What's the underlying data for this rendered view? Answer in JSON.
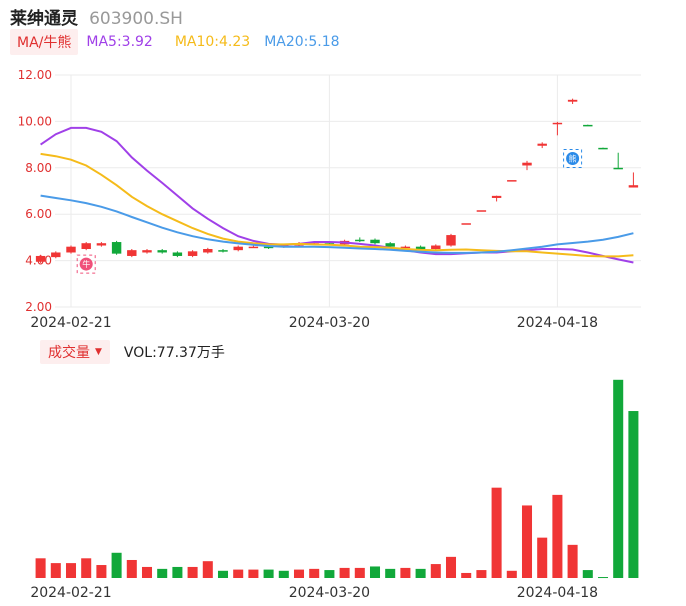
{
  "header": {
    "name": "莱绅通灵",
    "code": "603900.SH"
  },
  "ma_legend": {
    "tag": "MA/牛熊",
    "items": [
      {
        "label": "MA5:3.92",
        "color": "#a040e8"
      },
      {
        "label": "MA10:4.23",
        "color": "#f5bb1a"
      },
      {
        "label": "MA20:5.18",
        "color": "#4a9be8"
      }
    ]
  },
  "volume_legend": {
    "tag": "成交量",
    "label": "VOL:77.37万手"
  },
  "colors": {
    "up": "#f03535",
    "down": "#11a83a",
    "grid": "#ebebeb",
    "axis_text": "#e03030"
  },
  "chart_data": [
    {
      "type": "candlestick",
      "ylim": [
        2.0,
        12.0
      ],
      "yticks": [
        "2.00",
        "4.00",
        "6.00",
        "8.00",
        "10.00",
        "12.00"
      ],
      "xticks": [
        {
          "index": 2,
          "label": "2024-02-21"
        },
        {
          "index": 19,
          "label": "2024-03-20"
        },
        {
          "index": 34,
          "label": "2024-04-18"
        }
      ],
      "markers": [
        {
          "index": 3,
          "value": 3.85,
          "type": "bull",
          "glyph": "牛"
        },
        {
          "index": 35,
          "value": 8.4,
          "type": "bear",
          "glyph": "熊"
        }
      ],
      "candles": [
        {
          "o": 3.95,
          "c": 4.2,
          "h": 4.25,
          "l": 3.9
        },
        {
          "o": 4.15,
          "c": 4.35,
          "h": 4.4,
          "l": 4.1
        },
        {
          "o": 4.35,
          "c": 4.6,
          "h": 4.65,
          "l": 4.3
        },
        {
          "o": 4.5,
          "c": 4.75,
          "h": 4.8,
          "l": 4.45
        },
        {
          "o": 4.65,
          "c": 4.75,
          "h": 4.8,
          "l": 4.6
        },
        {
          "o": 4.8,
          "c": 4.3,
          "h": 4.85,
          "l": 4.25
        },
        {
          "o": 4.2,
          "c": 4.45,
          "h": 4.5,
          "l": 4.15
        },
        {
          "o": 4.35,
          "c": 4.45,
          "h": 4.5,
          "l": 4.3
        },
        {
          "o": 4.45,
          "c": 4.35,
          "h": 4.5,
          "l": 4.3
        },
        {
          "o": 4.35,
          "c": 4.2,
          "h": 4.4,
          "l": 4.15
        },
        {
          "o": 4.2,
          "c": 4.4,
          "h": 4.45,
          "l": 4.15
        },
        {
          "o": 4.35,
          "c": 4.5,
          "h": 4.55,
          "l": 4.3
        },
        {
          "o": 4.45,
          "c": 4.4,
          "h": 4.5,
          "l": 4.35
        },
        {
          "o": 4.45,
          "c": 4.6,
          "h": 4.65,
          "l": 4.4
        },
        {
          "o": 4.6,
          "c": 4.6,
          "h": 4.65,
          "l": 4.55
        },
        {
          "o": 4.6,
          "c": 4.55,
          "h": 4.65,
          "l": 4.5
        },
        {
          "o": 4.6,
          "c": 4.65,
          "h": 4.7,
          "l": 4.55
        },
        {
          "o": 4.65,
          "c": 4.75,
          "h": 4.8,
          "l": 4.6
        },
        {
          "o": 4.75,
          "c": 4.75,
          "h": 4.8,
          "l": 4.7
        },
        {
          "o": 4.75,
          "c": 4.7,
          "h": 4.8,
          "l": 4.65
        },
        {
          "o": 4.7,
          "c": 4.85,
          "h": 4.9,
          "l": 4.65
        },
        {
          "o": 4.9,
          "c": 4.85,
          "h": 5.0,
          "l": 4.8
        },
        {
          "o": 4.9,
          "c": 4.75,
          "h": 4.95,
          "l": 4.7
        },
        {
          "o": 4.75,
          "c": 4.6,
          "h": 4.8,
          "l": 4.55
        },
        {
          "o": 4.55,
          "c": 4.6,
          "h": 4.65,
          "l": 4.5
        },
        {
          "o": 4.6,
          "c": 4.5,
          "h": 4.65,
          "l": 4.45
        },
        {
          "o": 4.5,
          "c": 4.65,
          "h": 4.7,
          "l": 4.45
        },
        {
          "o": 4.65,
          "c": 5.1,
          "h": 5.15,
          "l": 4.6
        },
        {
          "o": 5.61,
          "c": 5.61,
          "h": 5.61,
          "l": 5.61
        },
        {
          "o": 6.17,
          "c": 6.17,
          "h": 6.17,
          "l": 6.17
        },
        {
          "o": 6.7,
          "c": 6.79,
          "h": 6.8,
          "l": 6.55
        },
        {
          "o": 7.47,
          "c": 7.47,
          "h": 7.47,
          "l": 7.47
        },
        {
          "o": 8.1,
          "c": 8.22,
          "h": 8.3,
          "l": 7.9
        },
        {
          "o": 8.95,
          "c": 9.04,
          "h": 9.1,
          "l": 8.85
        },
        {
          "o": 9.9,
          "c": 9.94,
          "h": 9.98,
          "l": 9.4
        },
        {
          "o": 10.85,
          "c": 10.93,
          "h": 10.98,
          "l": 10.75
        },
        {
          "o": 9.85,
          "c": 9.84,
          "h": 9.86,
          "l": 9.82
        },
        {
          "o": 8.86,
          "c": 8.85,
          "h": 8.87,
          "l": 8.84
        },
        {
          "o": 8.0,
          "c": 7.97,
          "h": 8.65,
          "l": 7.96
        },
        {
          "o": 7.15,
          "c": 7.25,
          "h": 7.8,
          "l": 7.15
        }
      ],
      "series": [
        {
          "name": "MA5",
          "color": "#a040e8",
          "values": [
            9.0,
            9.45,
            9.72,
            9.72,
            9.55,
            9.15,
            8.45,
            7.88,
            7.35,
            6.8,
            6.25,
            5.8,
            5.4,
            5.05,
            4.85,
            4.72,
            4.68,
            4.72,
            4.8,
            4.8,
            4.78,
            4.72,
            4.65,
            4.55,
            4.45,
            4.35,
            4.28,
            4.28,
            4.32,
            4.35,
            4.35,
            4.4,
            4.45,
            4.5,
            4.5,
            4.48,
            4.35,
            4.2,
            4.05,
            3.92
          ]
        },
        {
          "name": "MA10",
          "color": "#f5bb1a",
          "values": [
            8.6,
            8.5,
            8.35,
            8.1,
            7.7,
            7.25,
            6.75,
            6.35,
            6.0,
            5.7,
            5.4,
            5.15,
            4.95,
            4.82,
            4.75,
            4.7,
            4.7,
            4.72,
            4.7,
            4.68,
            4.65,
            4.6,
            4.58,
            4.55,
            4.5,
            4.46,
            4.45,
            4.47,
            4.48,
            4.45,
            4.42,
            4.4,
            4.4,
            4.35,
            4.3,
            4.25,
            4.2,
            4.18,
            4.18,
            4.23
          ]
        },
        {
          "name": "MA20",
          "color": "#4a9be8",
          "values": [
            6.8,
            6.7,
            6.6,
            6.48,
            6.32,
            6.12,
            5.88,
            5.65,
            5.42,
            5.22,
            5.05,
            4.92,
            4.82,
            4.74,
            4.68,
            4.63,
            4.6,
            4.6,
            4.6,
            4.58,
            4.55,
            4.52,
            4.5,
            4.47,
            4.42,
            4.38,
            4.35,
            4.33,
            4.33,
            4.35,
            4.38,
            4.45,
            4.52,
            4.6,
            4.7,
            4.76,
            4.82,
            4.9,
            5.02,
            5.18
          ]
        }
      ]
    },
    {
      "type": "bar",
      "title": "成交量",
      "unit": "万手",
      "ylim": [
        0,
        82
      ],
      "values": [
        8.2,
        6.2,
        6.2,
        8.2,
        5.4,
        10.5,
        7.5,
        4.6,
        3.8,
        4.6,
        4.6,
        7.0,
        3.0,
        3.5,
        3.5,
        3.5,
        3.0,
        3.5,
        3.8,
        3.3,
        4.2,
        4.2,
        4.8,
        3.8,
        4.2,
        3.8,
        5.8,
        8.8,
        2.1,
        3.3,
        37.6,
        3.0,
        30.2,
        16.8,
        34.6,
        13.8,
        3.3,
        0.4,
        82.5,
        69.5
      ],
      "directions": [
        "up",
        "up",
        "up",
        "up",
        "up",
        "down",
        "up",
        "up",
        "down",
        "down",
        "up",
        "up",
        "down",
        "up",
        "up",
        "down",
        "down",
        "up",
        "up",
        "down",
        "up",
        "up",
        "down",
        "down",
        "up",
        "down",
        "up",
        "up",
        "up",
        "up",
        "up",
        "up",
        "up",
        "up",
        "up",
        "up",
        "down",
        "down",
        "down",
        "down"
      ]
    }
  ]
}
